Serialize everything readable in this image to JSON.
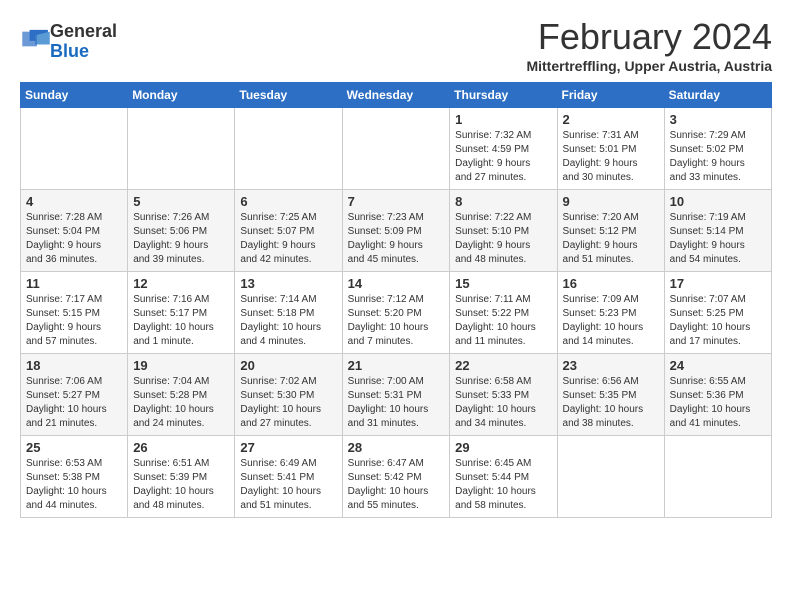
{
  "header": {
    "logo_general": "General",
    "logo_blue": "Blue",
    "month_title": "February 2024",
    "location": "Mittertreffling, Upper Austria, Austria"
  },
  "days_of_week": [
    "Sunday",
    "Monday",
    "Tuesday",
    "Wednesday",
    "Thursday",
    "Friday",
    "Saturday"
  ],
  "weeks": [
    [
      {
        "day": "",
        "info": ""
      },
      {
        "day": "",
        "info": ""
      },
      {
        "day": "",
        "info": ""
      },
      {
        "day": "",
        "info": ""
      },
      {
        "day": "1",
        "info": "Sunrise: 7:32 AM\nSunset: 4:59 PM\nDaylight: 9 hours\nand 27 minutes."
      },
      {
        "day": "2",
        "info": "Sunrise: 7:31 AM\nSunset: 5:01 PM\nDaylight: 9 hours\nand 30 minutes."
      },
      {
        "day": "3",
        "info": "Sunrise: 7:29 AM\nSunset: 5:02 PM\nDaylight: 9 hours\nand 33 minutes."
      }
    ],
    [
      {
        "day": "4",
        "info": "Sunrise: 7:28 AM\nSunset: 5:04 PM\nDaylight: 9 hours\nand 36 minutes."
      },
      {
        "day": "5",
        "info": "Sunrise: 7:26 AM\nSunset: 5:06 PM\nDaylight: 9 hours\nand 39 minutes."
      },
      {
        "day": "6",
        "info": "Sunrise: 7:25 AM\nSunset: 5:07 PM\nDaylight: 9 hours\nand 42 minutes."
      },
      {
        "day": "7",
        "info": "Sunrise: 7:23 AM\nSunset: 5:09 PM\nDaylight: 9 hours\nand 45 minutes."
      },
      {
        "day": "8",
        "info": "Sunrise: 7:22 AM\nSunset: 5:10 PM\nDaylight: 9 hours\nand 48 minutes."
      },
      {
        "day": "9",
        "info": "Sunrise: 7:20 AM\nSunset: 5:12 PM\nDaylight: 9 hours\nand 51 minutes."
      },
      {
        "day": "10",
        "info": "Sunrise: 7:19 AM\nSunset: 5:14 PM\nDaylight: 9 hours\nand 54 minutes."
      }
    ],
    [
      {
        "day": "11",
        "info": "Sunrise: 7:17 AM\nSunset: 5:15 PM\nDaylight: 9 hours\nand 57 minutes."
      },
      {
        "day": "12",
        "info": "Sunrise: 7:16 AM\nSunset: 5:17 PM\nDaylight: 10 hours\nand 1 minute."
      },
      {
        "day": "13",
        "info": "Sunrise: 7:14 AM\nSunset: 5:18 PM\nDaylight: 10 hours\nand 4 minutes."
      },
      {
        "day": "14",
        "info": "Sunrise: 7:12 AM\nSunset: 5:20 PM\nDaylight: 10 hours\nand 7 minutes."
      },
      {
        "day": "15",
        "info": "Sunrise: 7:11 AM\nSunset: 5:22 PM\nDaylight: 10 hours\nand 11 minutes."
      },
      {
        "day": "16",
        "info": "Sunrise: 7:09 AM\nSunset: 5:23 PM\nDaylight: 10 hours\nand 14 minutes."
      },
      {
        "day": "17",
        "info": "Sunrise: 7:07 AM\nSunset: 5:25 PM\nDaylight: 10 hours\nand 17 minutes."
      }
    ],
    [
      {
        "day": "18",
        "info": "Sunrise: 7:06 AM\nSunset: 5:27 PM\nDaylight: 10 hours\nand 21 minutes."
      },
      {
        "day": "19",
        "info": "Sunrise: 7:04 AM\nSunset: 5:28 PM\nDaylight: 10 hours\nand 24 minutes."
      },
      {
        "day": "20",
        "info": "Sunrise: 7:02 AM\nSunset: 5:30 PM\nDaylight: 10 hours\nand 27 minutes."
      },
      {
        "day": "21",
        "info": "Sunrise: 7:00 AM\nSunset: 5:31 PM\nDaylight: 10 hours\nand 31 minutes."
      },
      {
        "day": "22",
        "info": "Sunrise: 6:58 AM\nSunset: 5:33 PM\nDaylight: 10 hours\nand 34 minutes."
      },
      {
        "day": "23",
        "info": "Sunrise: 6:56 AM\nSunset: 5:35 PM\nDaylight: 10 hours\nand 38 minutes."
      },
      {
        "day": "24",
        "info": "Sunrise: 6:55 AM\nSunset: 5:36 PM\nDaylight: 10 hours\nand 41 minutes."
      }
    ],
    [
      {
        "day": "25",
        "info": "Sunrise: 6:53 AM\nSunset: 5:38 PM\nDaylight: 10 hours\nand 44 minutes."
      },
      {
        "day": "26",
        "info": "Sunrise: 6:51 AM\nSunset: 5:39 PM\nDaylight: 10 hours\nand 48 minutes."
      },
      {
        "day": "27",
        "info": "Sunrise: 6:49 AM\nSunset: 5:41 PM\nDaylight: 10 hours\nand 51 minutes."
      },
      {
        "day": "28",
        "info": "Sunrise: 6:47 AM\nSunset: 5:42 PM\nDaylight: 10 hours\nand 55 minutes."
      },
      {
        "day": "29",
        "info": "Sunrise: 6:45 AM\nSunset: 5:44 PM\nDaylight: 10 hours\nand 58 minutes."
      },
      {
        "day": "",
        "info": ""
      },
      {
        "day": "",
        "info": ""
      }
    ]
  ]
}
